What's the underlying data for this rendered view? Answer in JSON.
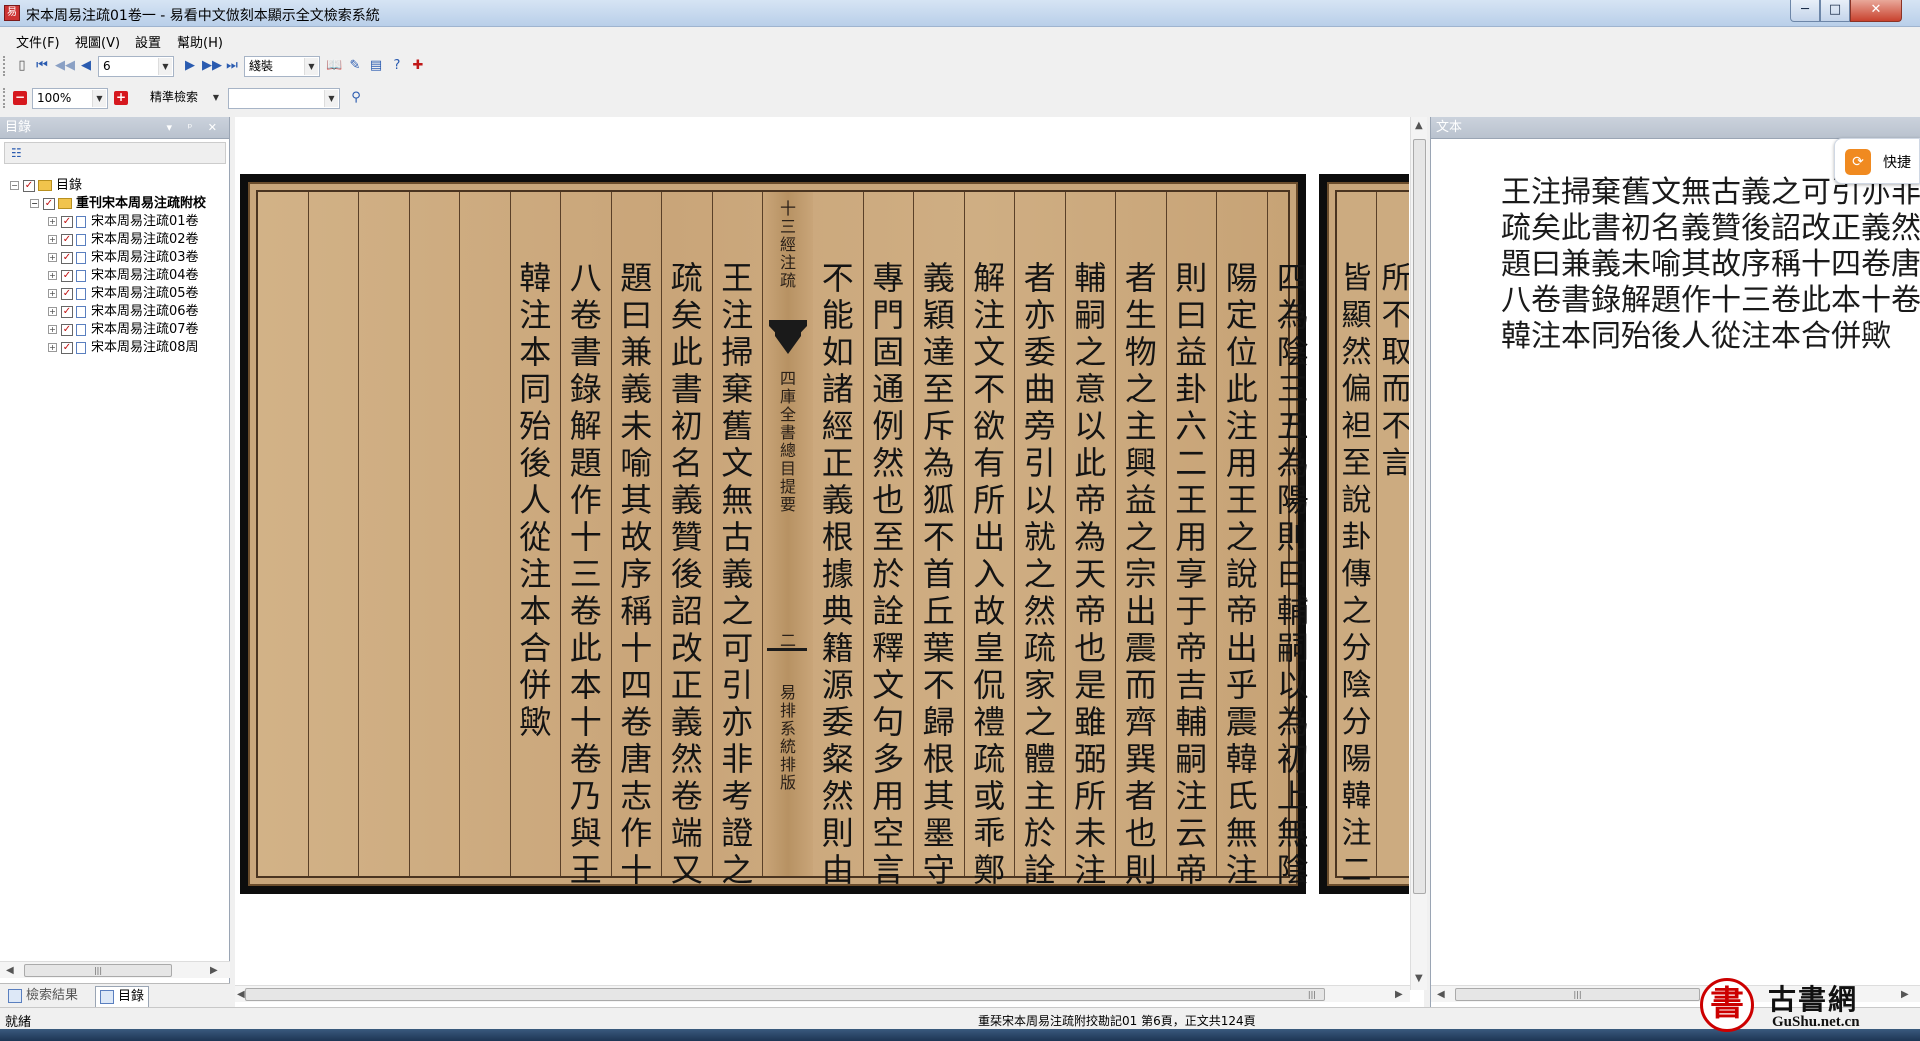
{
  "window": {
    "title": "宋本周易注疏01卷一 - 易看中文倣刻本顯示全文檢索系統",
    "minimize": "─",
    "maximize": "□",
    "close": "✕"
  },
  "menu": [
    "文件(F)",
    "視圖(V)",
    "設置",
    "幫助(H)"
  ],
  "toolbar": {
    "page_value": "6",
    "layout_value": "綫裝",
    "zoom_value": "100%",
    "search_mode": "精準檢索",
    "search_query": ""
  },
  "toc_panel": {
    "title": "目錄",
    "controls": "▾ ᵖ ✕",
    "root": "目錄",
    "book": "重刊宋本周易注疏附校",
    "items": [
      "宋本周易注疏01卷",
      "宋本周易注疏02卷",
      "宋本周易注疏03卷",
      "宋本周易注疏04卷",
      "宋本周易注疏05卷",
      "宋本周易注疏06卷",
      "宋本周易注疏07卷",
      "宋本周易注疏08周"
    ],
    "tabs": {
      "search": "檢索結果",
      "toc": "目錄"
    }
  },
  "page_scan": {
    "columns_right": [
      "四為陰三五為陽則曰輔嗣以為初上無陰",
      "陽定位此注用王之說帝出乎震韓氏無注",
      "則曰益卦六二王用享于帝吉輔嗣注云帝",
      "者生物之主興益之宗出震而齊巽者也則",
      "輔嗣之意以此帝為天帝也是雖弼所未注",
      "者亦委曲旁引以就之然疏家之體主於詮",
      "解注文不欲有所出入故皇侃禮疏或乖鄭",
      "義穎達至斥為狐不首丘葉不歸根其墨守",
      "專門固通例然也至於詮釋文句多用空言",
      "不能如諸經正義根據典籍源委粲然則由"
    ],
    "center_top": "十三經注疏",
    "center_mid": "四庫全書總目提要",
    "center_page": "二",
    "center_bottom": "易排系統排版",
    "columns_left": [
      "王注掃棄舊文無古義之可引亦非考證之",
      "疏矣此書初名義贊後詔改正義然卷端又",
      "題曰兼義未喻其故序稱十四卷唐志作十",
      "八卷書錄解題作十三卷此本十卷乃與王",
      "韓注本同殆後人從注本合併歟",
      "",
      "",
      "",
      "",
      ""
    ],
    "page2_columns": [
      "所不取而不言",
      "皆顯然偏袒至說卦傳之分陰分陽韓注二"
    ]
  },
  "text_panel": {
    "title": "文本",
    "lines": [
      "王注掃棄舊文無古義之可引亦非考證之",
      "疏矣此書初名義贊後詔改正義然卷端又",
      "題曰兼義未喻其故序稱十四卷唐志作十",
      "八卷書錄解題作十三卷此本十卷乃與王",
      "韓注本同殆後人從注本合併歟"
    ],
    "quick_label": "快捷"
  },
  "status": {
    "left": "就緒",
    "center": "重栞宋本周易注疏附挍勘記01 第6頁，正文共124頁"
  },
  "watermark": {
    "seal": "書",
    "title": "古書網",
    "url": "GuShu.net.cn"
  }
}
